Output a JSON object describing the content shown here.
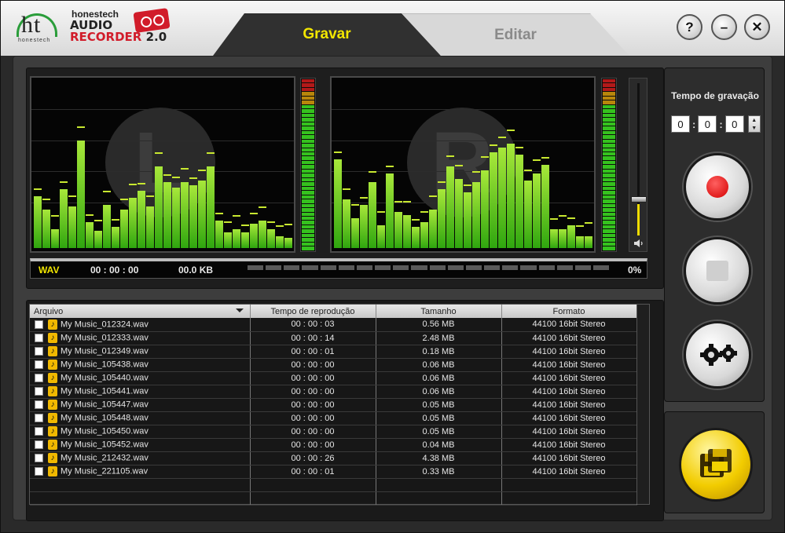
{
  "app": {
    "company_small": "honestech",
    "brand_small": "honestech",
    "brand_line1": "AUDIO",
    "brand_line2": "RECORDER",
    "brand_version": "2.0"
  },
  "tabs": [
    {
      "label": "Gravar",
      "active": true
    },
    {
      "label": "Editar",
      "active": false
    }
  ],
  "window_buttons": {
    "help": "?",
    "minimize": "–",
    "close": "✕"
  },
  "visualizer": {
    "left_channel": "L",
    "right_channel": "R",
    "left_bars": [
      0.3,
      0.22,
      0.11,
      0.34,
      0.24,
      0.62,
      0.15,
      0.1,
      0.25,
      0.12,
      0.22,
      0.29,
      0.33,
      0.24,
      0.47,
      0.38,
      0.35,
      0.38,
      0.36,
      0.39,
      0.47,
      0.16,
      0.09,
      0.11,
      0.09,
      0.14,
      0.16,
      0.11,
      0.07,
      0.06
    ],
    "right_bars": [
      0.51,
      0.28,
      0.17,
      0.25,
      0.38,
      0.13,
      0.43,
      0.21,
      0.19,
      0.12,
      0.15,
      0.22,
      0.34,
      0.47,
      0.4,
      0.32,
      0.38,
      0.45,
      0.55,
      0.58,
      0.6,
      0.54,
      0.39,
      0.43,
      0.48,
      0.11,
      0.11,
      0.13,
      0.07,
      0.07
    ],
    "colors": {
      "bar": "#6ccf20",
      "peak": "#c8e830",
      "vu_red": "#b31919",
      "vu_orange": "#b8860b",
      "vu_green": "#35c21e"
    }
  },
  "status": {
    "format": "WAV",
    "time": "00 : 00 : 00",
    "size": "00.0 KB",
    "progress": "0%"
  },
  "file_list": {
    "columns": [
      "Arquivo",
      "Tempo de reprodução",
      "Tamanho",
      "Formato"
    ],
    "rows": [
      {
        "name": "My Music_012324.wav",
        "time": "00 : 00 : 03",
        "size": "0.56 MB",
        "format": "44100 16bit Stereo"
      },
      {
        "name": "My Music_012333.wav",
        "time": "00 : 00 : 14",
        "size": "2.48 MB",
        "format": "44100 16bit Stereo"
      },
      {
        "name": "My Music_012349.wav",
        "time": "00 : 00 : 01",
        "size": "0.18 MB",
        "format": "44100 16bit Stereo"
      },
      {
        "name": "My Music_105438.wav",
        "time": "00 : 00 : 00",
        "size": "0.06 MB",
        "format": "44100 16bit Stereo"
      },
      {
        "name": "My Music_105440.wav",
        "time": "00 : 00 : 00",
        "size": "0.06 MB",
        "format": "44100 16bit Stereo"
      },
      {
        "name": "My Music_105441.wav",
        "time": "00 : 00 : 00",
        "size": "0.06 MB",
        "format": "44100 16bit Stereo"
      },
      {
        "name": "My Music_105447.wav",
        "time": "00 : 00 : 00",
        "size": "0.05 MB",
        "format": "44100 16bit Stereo"
      },
      {
        "name": "My Music_105448.wav",
        "time": "00 : 00 : 00",
        "size": "0.05 MB",
        "format": "44100 16bit Stereo"
      },
      {
        "name": "My Music_105450.wav",
        "time": "00 : 00 : 00",
        "size": "0.05 MB",
        "format": "44100 16bit Stereo"
      },
      {
        "name": "My Music_105452.wav",
        "time": "00 : 00 : 00",
        "size": "0.04 MB",
        "format": "44100 16bit Stereo"
      },
      {
        "name": "My Music_212432.wav",
        "time": "00 : 00 : 26",
        "size": "4.38 MB",
        "format": "44100 16bit Stereo"
      },
      {
        "name": "My Music_221105.wav",
        "time": "00 : 00 : 01",
        "size": "0.33 MB",
        "format": "44100 16bit Stereo"
      }
    ]
  },
  "recorder": {
    "title": "Tempo de gravação",
    "hours": "0",
    "minutes": "0",
    "seconds": "0"
  },
  "icons": {
    "record": "record-icon",
    "stop": "stop-icon",
    "settings": "gears-icon",
    "save": "floppy-disk-icon",
    "volume": "speaker-icon"
  }
}
